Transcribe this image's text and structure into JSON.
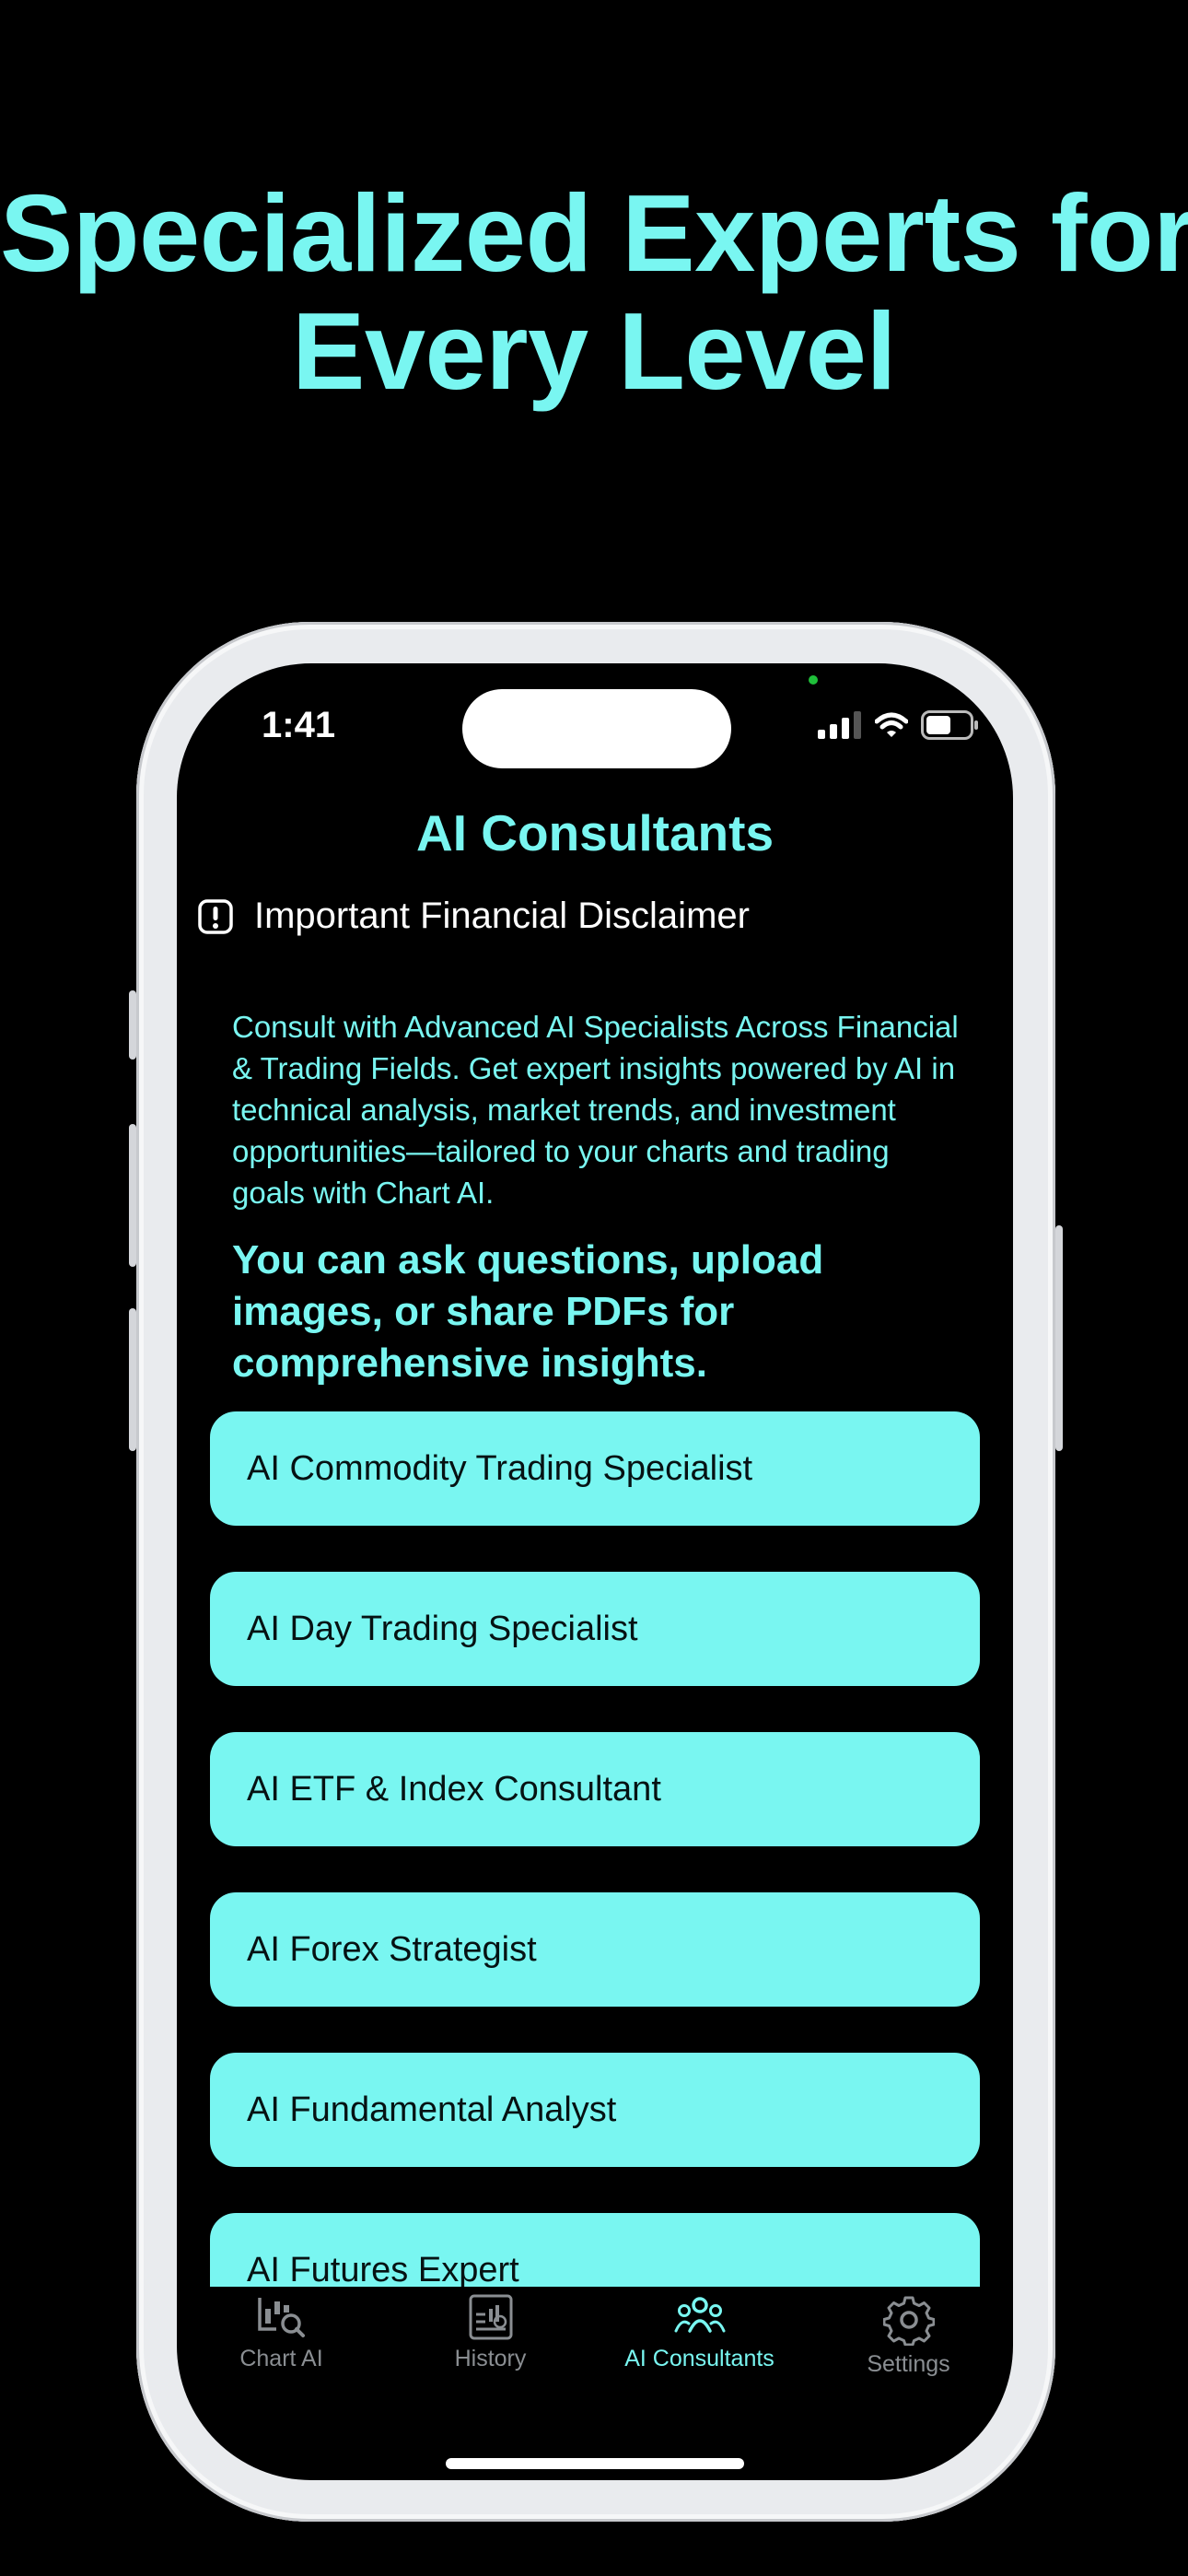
{
  "headline": {
    "line1": "Specialized Experts for",
    "line2": "Every Level"
  },
  "status_bar": {
    "time": "1:41",
    "icons": [
      "signal-icon",
      "wifi-icon",
      "battery-icon"
    ]
  },
  "page_title": "AI Consultants",
  "disclaimer": {
    "icon": "exclamation-icon",
    "label": "Important Financial Disclaimer"
  },
  "intro": "Consult with Advanced AI Specialists Across Financial & Trading Fields. Get expert insights powered by AI in technical analysis, market trends, and investment opportunities—tailored to your charts and trading goals with Chart AI.",
  "ask_text": "You can ask questions, upload images, or share PDFs for comprehensive insights.",
  "consultants": [
    "AI Commodity Trading Specialist",
    "AI Day Trading Specialist",
    "AI ETF & Index Consultant",
    "AI Forex Strategist",
    "AI Fundamental Analyst",
    "AI Futures Expert"
  ],
  "tabs": [
    {
      "label": "Chart AI",
      "icon": "chart-search-icon",
      "active": false
    },
    {
      "label": "History",
      "icon": "history-icon",
      "active": false
    },
    {
      "label": "AI Consultants",
      "icon": "people-icon",
      "active": true
    },
    {
      "label": "Settings",
      "icon": "gear-icon",
      "active": false
    }
  ],
  "colors": {
    "accent": "#79f6f1",
    "background": "#000000",
    "inactive_tab": "#8a8e92"
  }
}
